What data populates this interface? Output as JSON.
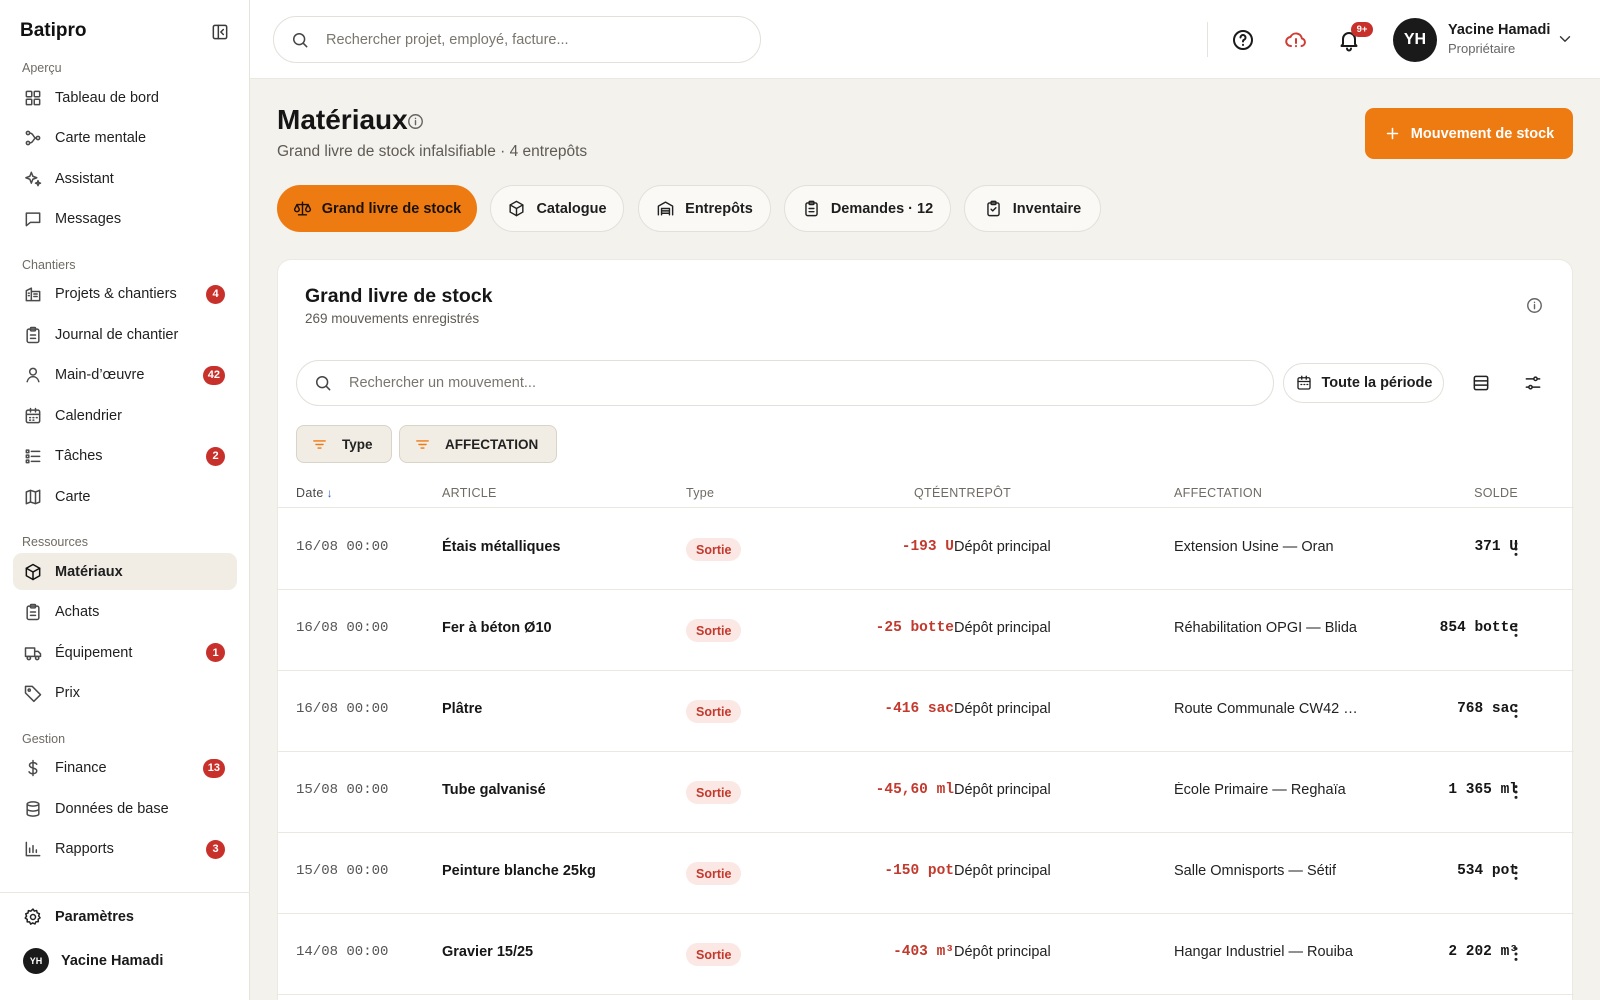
{
  "app": {
    "brand": "Batipro"
  },
  "sidebar": {
    "sections": [
      {
        "label": "Aperçu",
        "items": [
          {
            "label": "Tableau de bord",
            "icon": "grid-icon"
          },
          {
            "label": "Carte mentale",
            "icon": "mindmap-icon"
          },
          {
            "label": "Assistant",
            "icon": "sparkles-icon"
          },
          {
            "label": "Messages",
            "icon": "message-icon"
          }
        ]
      },
      {
        "label": "Chantiers",
        "items": [
          {
            "label": "Projets & chantiers",
            "icon": "building-icon",
            "badge": "4"
          },
          {
            "label": "Journal de chantier",
            "icon": "clipboard-icon"
          },
          {
            "label": "Main-d’œuvre",
            "icon": "user-icon",
            "badge": "42"
          },
          {
            "label": "Calendrier",
            "icon": "calendar-icon"
          },
          {
            "label": "Tâches",
            "icon": "checklist-icon",
            "badge": "2"
          },
          {
            "label": "Carte",
            "icon": "map-icon"
          }
        ]
      },
      {
        "label": "Ressources",
        "items": [
          {
            "label": "Matériaux",
            "icon": "box-icon",
            "active": true
          },
          {
            "label": "Achats",
            "icon": "clipboard-icon"
          },
          {
            "label": "Équipement",
            "icon": "truck-icon",
            "badge": "1"
          },
          {
            "label": "Prix",
            "icon": "tag-icon"
          }
        ]
      },
      {
        "label": "Gestion",
        "items": [
          {
            "label": "Finance",
            "icon": "dollar-icon",
            "badge": "13"
          },
          {
            "label": "Données de base",
            "icon": "database-icon"
          },
          {
            "label": "Rapports",
            "icon": "bar-chart-icon",
            "badge": "3"
          }
        ]
      }
    ],
    "settings_label": "Paramètres",
    "user_initials": "YH",
    "user_name": "Yacine Hamadi"
  },
  "topbar": {
    "search_placeholder": "Rechercher projet, employé, facture...",
    "notif_badge": "9+",
    "user_initials": "YH",
    "user_name": "Yacine Hamadi",
    "user_role": "Propriétaire"
  },
  "page": {
    "title": "Matériaux",
    "subtitle": "Grand livre de stock infalsifiable · 4 entrepôts",
    "primary_action": "Mouvement de stock",
    "accent_color": "#ee7a12"
  },
  "tabs": [
    {
      "label": "Grand livre de stock",
      "icon": "scale-icon",
      "active": true
    },
    {
      "label": "Catalogue",
      "icon": "box-icon"
    },
    {
      "label": "Entrepôts",
      "icon": "warehouse-icon"
    },
    {
      "label": "Demandes · 12",
      "icon": "clipboard-icon"
    },
    {
      "label": "Inventaire",
      "icon": "clipboard-check-icon"
    }
  ],
  "ledger": {
    "title": "Grand livre de stock",
    "subtitle": "269 mouvements enregistrés",
    "search_placeholder": "Rechercher un mouvement...",
    "period_label": "Toute la période",
    "filters": [
      "Type",
      "AFFECTATION"
    ],
    "columns": {
      "date": "Date",
      "article": "ARTICLE",
      "type": "Type",
      "qty_warehouse": "QTÉENTREPÔT",
      "assignment": "AFFECTATION",
      "balance": "SOLDE"
    },
    "rows": [
      {
        "date": "16/08 00:00",
        "article": "Étais métalliques",
        "type": "Sortie",
        "qty": "-193 U",
        "warehouse": "Dépôt principal",
        "assignment": "Extension Usine — Oran",
        "balance": "371 U"
      },
      {
        "date": "16/08 00:00",
        "article": "Fer à béton Ø10",
        "type": "Sortie",
        "qty": "-25 botte",
        "warehouse": "Dépôt principal",
        "assignment": "Réhabilitation OPGI — Blida",
        "balance": "854 botte"
      },
      {
        "date": "16/08 00:00",
        "article": "Plâtre",
        "type": "Sortie",
        "qty": "-416 sac",
        "warehouse": "Dépôt principal",
        "assignment": "Route Communale CW42 — …",
        "balance": "768 sac"
      },
      {
        "date": "15/08 00:00",
        "article": "Tube galvanisé",
        "type": "Sortie",
        "qty": "-45,60 ml",
        "warehouse": "Dépôt principal",
        "assignment": "École Primaire — Reghaïa",
        "balance": "1 365 ml"
      },
      {
        "date": "15/08 00:00",
        "article": "Peinture blanche 25kg",
        "type": "Sortie",
        "qty": "-150 pot",
        "warehouse": "Dépôt principal",
        "assignment": "Salle Omnisports — Sétif",
        "balance": "534 pot"
      },
      {
        "date": "14/08 00:00",
        "article": "Gravier 15/25",
        "type": "Sortie",
        "qty": "-403 m³",
        "warehouse": "Dépôt principal",
        "assignment": "Hangar Industriel — Rouiba",
        "balance": "2 202 m³"
      }
    ]
  }
}
